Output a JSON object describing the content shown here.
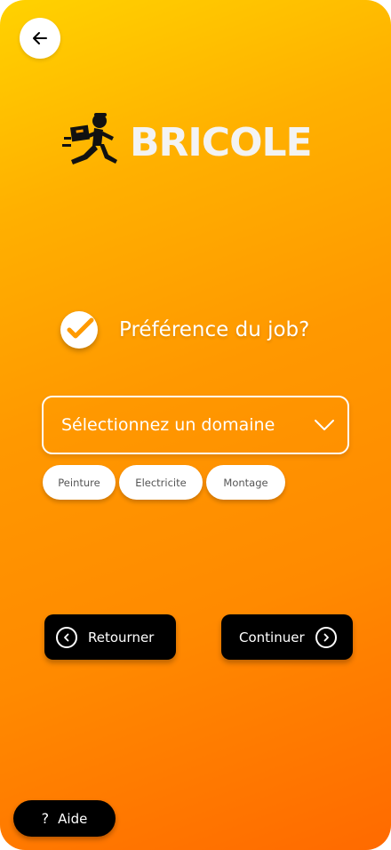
{
  "header": {
    "back_icon": "arrow-left-icon",
    "brand_name": "BRICOLE",
    "brand_icon": "running-delivery-man-icon"
  },
  "preference": {
    "title": "Préférence du job?",
    "check_icon": "check-circle-icon"
  },
  "domain_select": {
    "label": "Sélectionnez un domaine",
    "icon": "chevron-down-icon"
  },
  "chips": [
    {
      "label": "Peinture"
    },
    {
      "label": "Electricite"
    },
    {
      "label": "Montage"
    }
  ],
  "actions": {
    "back_label": "Retourner",
    "back_icon": "chevron-left-circle-icon",
    "continue_label": "Continuer",
    "continue_icon": "chevron-right-circle-icon"
  },
  "help": {
    "label": "Aide",
    "icon_glyph": "?"
  },
  "colors": {
    "gradient_top": "#ffd200",
    "gradient_bottom": "#ff6a00",
    "button_dark": "#000000",
    "white": "#ffffff"
  }
}
